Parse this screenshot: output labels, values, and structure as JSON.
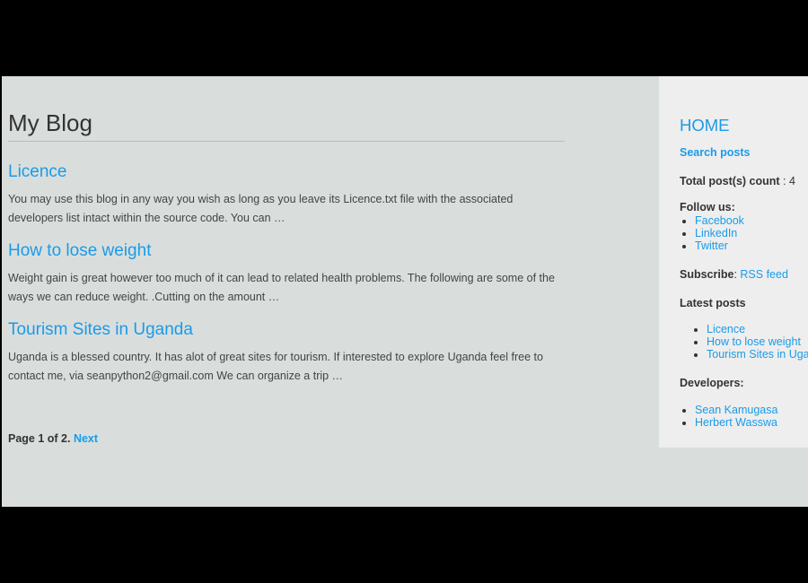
{
  "blog": {
    "title": "My Blog",
    "posts": [
      {
        "title": "Licence",
        "excerpt": "You may use this blog in any way you wish as long as you leave its Licence.txt file with the associated developers list intact within the source code. You can …"
      },
      {
        "title": "How to lose weight",
        "excerpt": "Weight gain is great however too much of it can lead to related health problems. The following are some of the ways we can reduce weight. .Cutting on the amount …"
      },
      {
        "title": "Tourism Sites in Uganda",
        "excerpt": "Uganda is a blessed country. It has alot of great sites for tourism. If interested to explore Uganda feel free to contact me, via seanpython2@gmail.com We can organize a trip …"
      }
    ],
    "pager": {
      "text": "Page 1 of 2.",
      "next_label": "Next"
    }
  },
  "sidebar": {
    "home_label": "HOME",
    "search_label": "Search posts",
    "post_count_label": "Total post(s) count",
    "post_count_sep": " : ",
    "post_count_value": "4",
    "follow_label": "Follow us:",
    "follow_links": [
      "Facebook",
      "LinkedIn",
      "Twitter"
    ],
    "subscribe_label": "Subscribe",
    "subscribe_sep": ": ",
    "rss_label": "RSS feed",
    "latest_label": "Latest posts",
    "latest_posts": [
      "Licence",
      "How to lose weight",
      "Tourism Sites in Uganda"
    ],
    "developers_label": "Developers:",
    "developers": [
      "Sean Kamugasa",
      "Herbert Wasswa"
    ]
  },
  "colors": {
    "link": "#1a9be8",
    "content_bg": "#d9dedd",
    "sidebar_bg": "#eeeeee",
    "frame_bg": "#000000"
  }
}
